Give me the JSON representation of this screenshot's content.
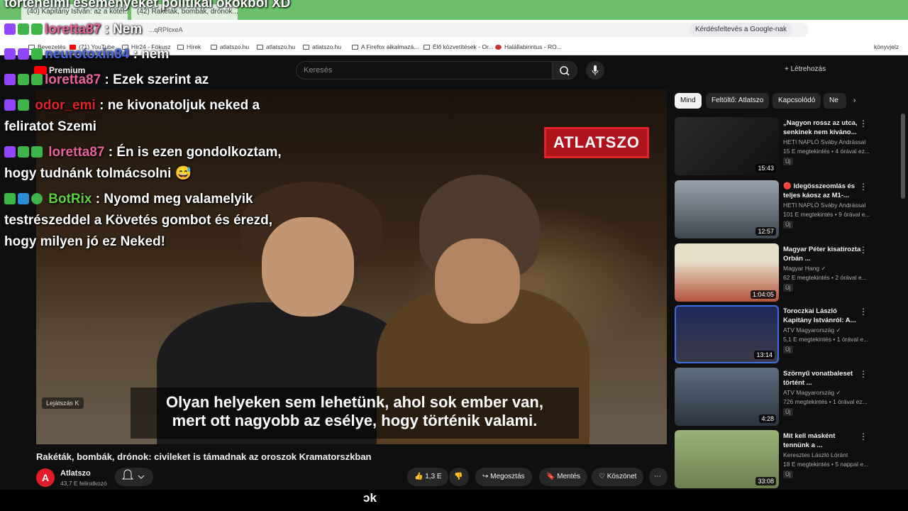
{
  "browser": {
    "tabs": [
      "(40) Kapitány István: az a kötél...",
      "(42) Rakéták, bombák, drónok..."
    ],
    "url": "...qRPIcxeA",
    "google_button": "Kérdésfeltevés a Google-nak",
    "bookmarks": [
      "Bevezetés",
      "(71) YouTube",
      "Hír24 - Fókusz",
      "Hírek",
      "atlatszo.hu",
      "atlatszo.hu",
      "atlatszo.hu",
      "A Firefox alkalmazá...",
      "Élő közvetítések - Or...",
      "Halállabirintus - RO..."
    ],
    "bookmarks_other": "könyvjelz"
  },
  "youtube": {
    "logo": "Premium",
    "search_placeholder": "Keresés",
    "create": "Létrehozás"
  },
  "player": {
    "watermark": "ATLATSZO",
    "caption_line1": "Olyan helyeken sem lehetünk, ahol sok ember van,",
    "caption_line2": "mert ott nagyobb az esélye, hogy történik valami.",
    "play_hint": "Lejátszás",
    "play_key": "K"
  },
  "chat": {
    "overlay_top": "történelmi eseményeket politikai okokból XD",
    "messages": [
      {
        "nick": "loretta87",
        "text": " : Nem",
        "color": "pink"
      },
      {
        "nick": "neurotoxin84",
        "text": " : nem",
        "color": "blue"
      },
      {
        "nick": "loretta87",
        "text": " : Ezek szerint az",
        "color": "pink"
      },
      {
        "nick": "odor_emi",
        "text": " : ne kivonatoljuk neked a",
        "text2": "feliratot Szemi",
        "color": "red"
      },
      {
        "nick": "loretta87",
        "text": " : Én is ezen gondolkoztam,",
        "text2": "hogy tudnánk tolmácsolni 😅",
        "color": "pink"
      },
      {
        "nick": "BotRix",
        "text": " : Nyomd meg valamelyik",
        "text2": "testrészeddel a Követés gombot és érezd,",
        "text3": "hogy milyen jó ez Neked!",
        "color": "green"
      }
    ]
  },
  "video": {
    "title": "Rakéták, bombák, drónok: civileket is támadnak az oroszok Kramatorszkban",
    "channel": "Atlatszo",
    "subs": "43,7 E feliratkozó",
    "likes": "1,3 E",
    "share": "Megosztás",
    "save": "Mentés",
    "thanks": "Köszönet"
  },
  "chips": [
    "Mind",
    "Feltöltő: Atlatszo",
    "Kapcsolódó",
    "Ne"
  ],
  "recommendations": [
    {
      "title": "„Nagyon rossz az utca, senkinek nem kívánо...",
      "channel": "HETI NAPLÓ Sváby Andrással",
      "meta": "15 E megtekintés • 4 órával ez...",
      "duration": "15:43",
      "badge": "Új"
    },
    {
      "title": "🔴 Idegösszeomlás és teljes káosz az M1-...",
      "channel": "HETI NAPLÓ Sváby Andrással",
      "meta": "101 E megtekintés • 9 órával e...",
      "duration": "12:57",
      "badge": "Új"
    },
    {
      "title": "Magyar Péter kisatírozta Orbán ...",
      "channel": "Magyar Hang ✓",
      "meta": "62 E megtekintés • 2 órával e...",
      "duration": "1:04:05",
      "badge": "Új"
    },
    {
      "title": "Toroczkai László Kapitány Istvánról: A...",
      "channel": "ATV Magyarország ✓",
      "meta": "5,1 E megtekintés • 1 órával e...",
      "duration": "13:14",
      "badge": "Új"
    },
    {
      "title": "Szörnyű vonatbaleset történt ...",
      "channel": "ATV Magyarország ✓",
      "meta": "726 megtekintés • 1 órával ez...",
      "duration": "4:28",
      "badge": "Új"
    },
    {
      "title": "Mit kell másként tennünk a ...",
      "channel": "Keresztes László Lóránt",
      "meta": "18 E megtekintés • 5 nappal e...",
      "duration": "33:08",
      "badge": "Új"
    }
  ],
  "overlay_bottom": "ɔk"
}
